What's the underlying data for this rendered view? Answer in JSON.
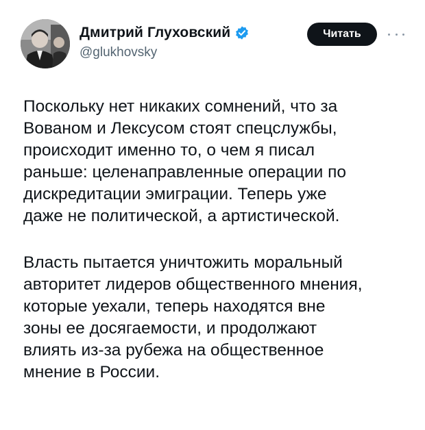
{
  "author": {
    "display_name": "Дмитрий Глуховский",
    "handle": "@glukhovsky",
    "verified": true
  },
  "actions": {
    "follow_label": "Читать",
    "more_icon": "more-horizontal-icon"
  },
  "tweet": {
    "paragraphs": [
      "Поскольку нет никаких сомнений, что за\nВованом и Лексусом стоят спецслужбы,\nпроисходит именно то, о чем я писал\nраньше: целенаправленные операции по\nдискредитации эмиграции. Теперь уже\nдаже не политической, а артистической.",
      "Власть пытается уничтожить моральный\nавторитет лидеров общественного мнения,\nкоторые уехали, теперь находятся вне\nзоны ее досягаемости, и продолжают\nвлиять из-за рубежа на общественное\nмнение в России."
    ]
  },
  "colors": {
    "text": "#0f1419",
    "secondary_text": "#536471",
    "verified_badge": "#1d9bf0",
    "button_bg": "#0f1419",
    "button_text": "#ffffff"
  }
}
